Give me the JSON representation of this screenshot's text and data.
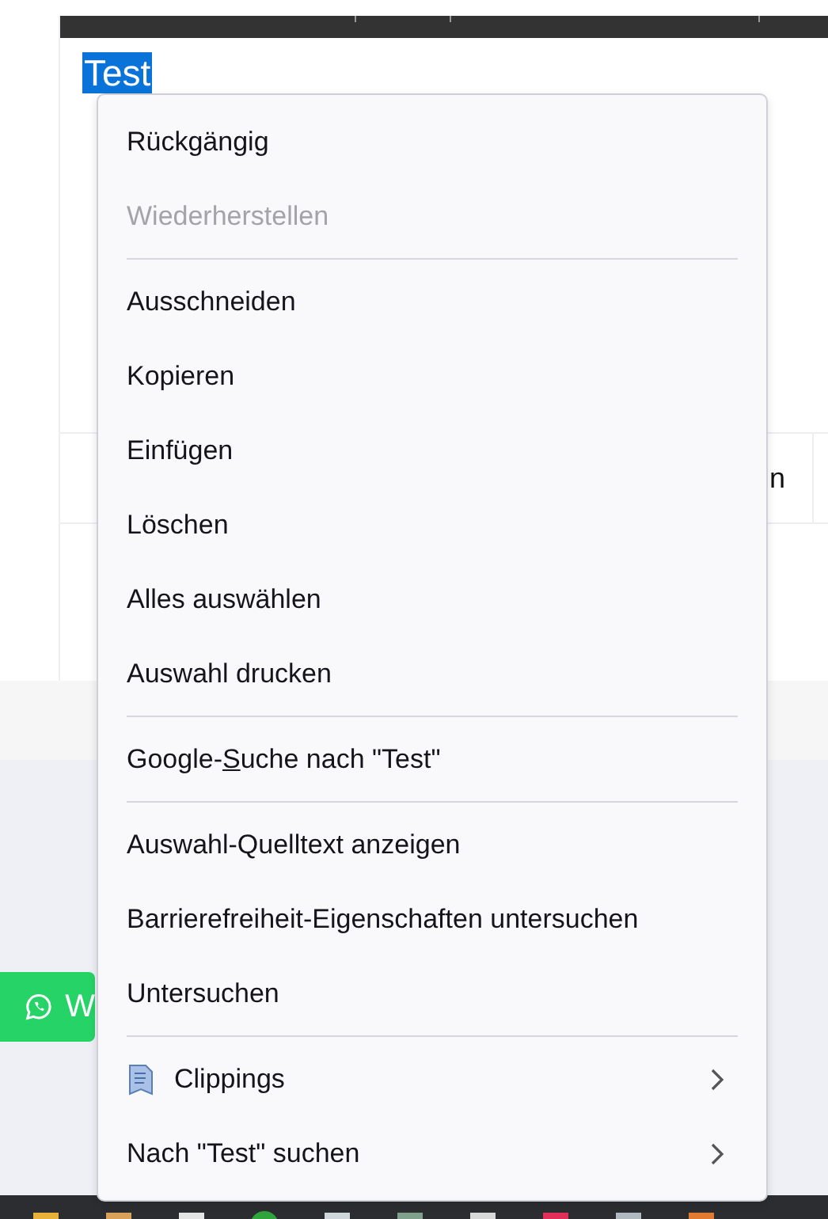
{
  "page": {
    "selected_text": "Test",
    "table_cell_text": "n",
    "whatsapp_button": "W"
  },
  "context_menu": {
    "items": [
      {
        "kind": "item",
        "label": "Rückgängig",
        "disabled": false
      },
      {
        "kind": "item",
        "label": "Wiederherstellen",
        "disabled": true
      },
      {
        "kind": "separator"
      },
      {
        "kind": "item",
        "label": "Ausschneiden",
        "disabled": false
      },
      {
        "kind": "item",
        "label": "Kopieren",
        "disabled": false
      },
      {
        "kind": "item",
        "label": "Einfügen",
        "disabled": false
      },
      {
        "kind": "item",
        "label": "Löschen",
        "disabled": false
      },
      {
        "kind": "item",
        "label": "Alles auswählen",
        "disabled": false
      },
      {
        "kind": "item",
        "label": "Auswahl drucken",
        "disabled": false
      },
      {
        "kind": "separator"
      },
      {
        "kind": "access_key_item",
        "label": "Google-",
        "access_key": "S",
        "label_rest": "uche nach \"Test\"",
        "disabled": false
      },
      {
        "kind": "separator"
      },
      {
        "kind": "item",
        "label": "Auswahl-Quelltext anzeigen",
        "disabled": false
      },
      {
        "kind": "item",
        "label": "Barrierefreiheit-Eigenschaften untersuchen",
        "disabled": false
      },
      {
        "kind": "item",
        "label": "Untersuchen",
        "disabled": false
      },
      {
        "kind": "separator"
      },
      {
        "kind": "icon_submenu",
        "label": "Clippings",
        "disabled": false
      },
      {
        "kind": "submenu",
        "label": "Nach \"Test\" suchen",
        "disabled": false
      }
    ]
  }
}
